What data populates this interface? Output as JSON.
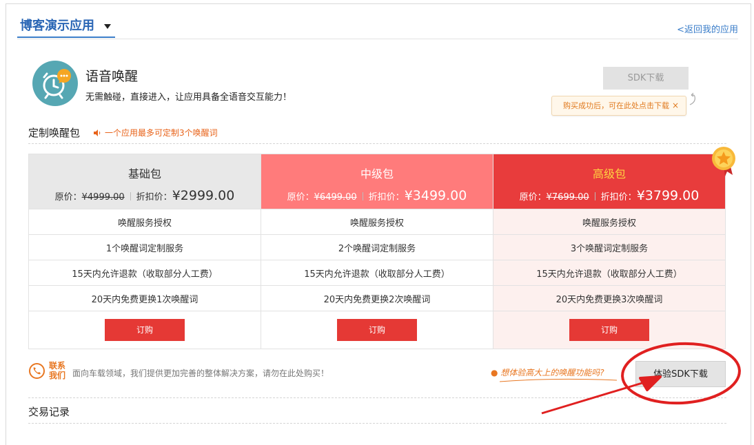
{
  "header": {
    "app_title": "博客演示应用",
    "back_link": "<返回我的应用"
  },
  "product": {
    "icon": "alarm-clock-chat-icon",
    "name": "语音唤醒",
    "description": "无需触碰，直接进入，让应用具备全语音交互能力！",
    "sdk_download": "SDK下载",
    "tip": "购买成功后，可在此处点击下载",
    "tip_close": "×"
  },
  "custom_section": {
    "title": "定制唤醒包",
    "hint": "一个应用最多可定制3个唤醒词"
  },
  "packages": [
    {
      "name": "基础包",
      "orig_label": "原价：",
      "orig_price": "¥4999.00",
      "disc_label": "折扣价：",
      "disc_price": "¥2999.00",
      "features": [
        "唤醒服务授权",
        "1个唤醒词定制服务",
        "15天内允许退款（收取部分人工费）",
        "20天内免费更换1次唤醒词"
      ],
      "buy": "订购"
    },
    {
      "name": "中级包",
      "orig_label": "原价：",
      "orig_price": "¥6499.00",
      "disc_label": "折扣价：",
      "disc_price": "¥3499.00",
      "features": [
        "唤醒服务授权",
        "2个唤醒词定制服务",
        "15天内允许退款（收取部分人工费）",
        "20天内免费更换2次唤醒词"
      ],
      "buy": "订购"
    },
    {
      "name": "高级包",
      "orig_label": "原价：",
      "orig_price": "¥7699.00",
      "disc_label": "折扣价：",
      "disc_price": "¥3799.00",
      "features": [
        "唤醒服务授权",
        "3个唤醒词定制服务",
        "15天内允许退款（收取部分人工费）",
        "20天内免费更换3次唤醒词"
      ],
      "buy": "订购"
    }
  ],
  "contact": {
    "label_line1": "联系",
    "label_line2": "我们",
    "description": "面向车载领域，我们提供更加完善的整体解决方案，请勿在此处购买！",
    "promo": "● 想体验高大上的唤醒功能吗?",
    "sdk_trial": "体验SDK下载"
  },
  "records": {
    "title": "交易记录"
  },
  "colors": {
    "accent_blue": "#2a66b5",
    "basic_header": "#e8e8e8",
    "mid_header": "#ff7b7b",
    "pro_header": "#e83c3c",
    "buy_button": "#e53935",
    "annotation_red": "#e02020"
  }
}
